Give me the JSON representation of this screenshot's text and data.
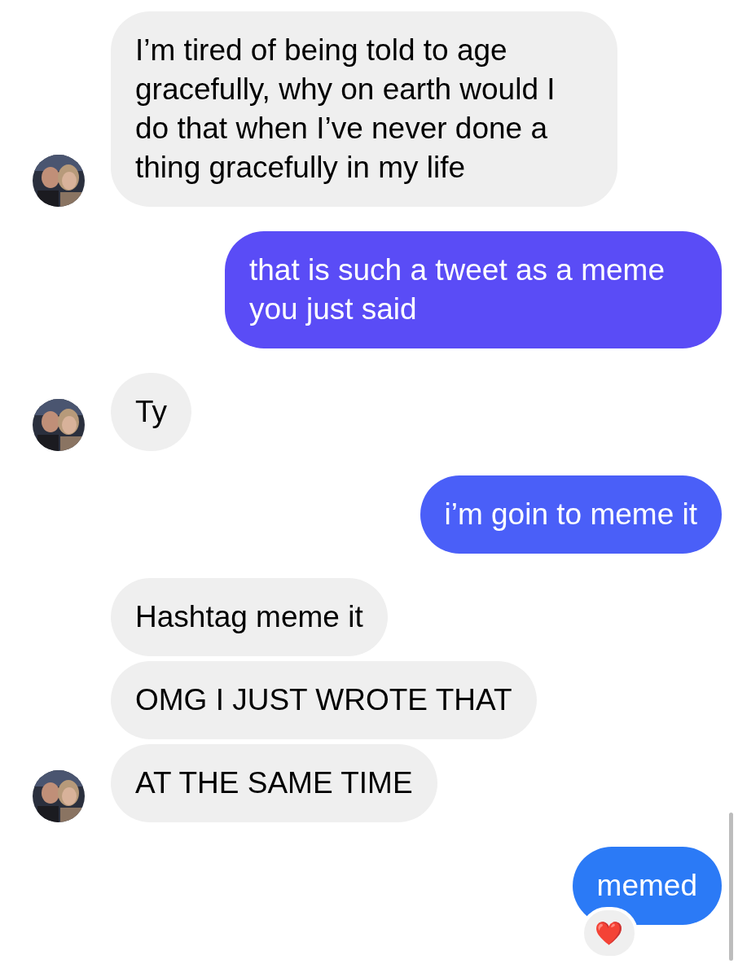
{
  "groups": [
    {
      "kind": "incoming",
      "messages": [
        {
          "text": "I’m tired of being told to age gracefully, why on earth would I do that when I’ve never done a thing gracefully in my life"
        }
      ]
    },
    {
      "kind": "outgoing",
      "messages": [
        {
          "text": "that is such a tweet as a meme you just said",
          "color": "#5a4cf6"
        }
      ]
    },
    {
      "kind": "incoming",
      "messages": [
        {
          "text": "Ty"
        }
      ]
    },
    {
      "kind": "outgoing",
      "messages": [
        {
          "text": "i’m goin to meme it",
          "color": "#4a5ff8"
        }
      ]
    },
    {
      "kind": "incoming",
      "messages": [
        {
          "text": "Hashtag meme it"
        },
        {
          "text": "OMG I JUST WROTE THAT"
        },
        {
          "text": "AT THE SAME TIME"
        }
      ]
    },
    {
      "kind": "outgoing",
      "messages": [
        {
          "text": "memed",
          "color": "#2b7af6",
          "reaction": "❤️"
        }
      ]
    }
  ]
}
